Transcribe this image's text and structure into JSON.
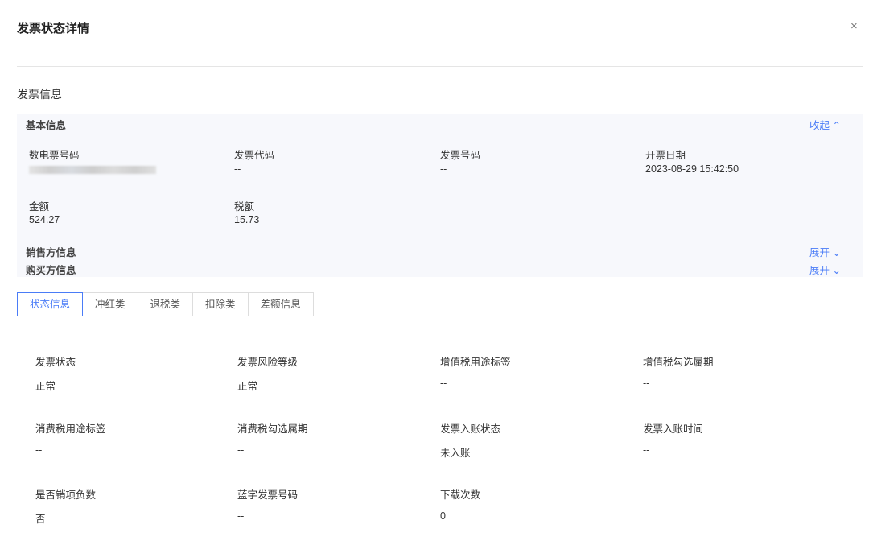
{
  "dialog": {
    "title": "发票状态详情",
    "close": "×"
  },
  "section_title": "发票信息",
  "basic": {
    "title": "基本信息",
    "toggle": "收起 ⌃",
    "fields": [
      {
        "label": "数电票号码",
        "value": ""
      },
      {
        "label": "发票代码",
        "value": "--"
      },
      {
        "label": "发票号码",
        "value": "--"
      },
      {
        "label": "开票日期",
        "value": "2023-08-29 15:42:50"
      },
      {
        "label": "金额",
        "value": "524.27"
      },
      {
        "label": "税额",
        "value": "15.73"
      }
    ]
  },
  "seller": {
    "title": "销售方信息",
    "toggle": "展开 ⌄"
  },
  "buyer": {
    "title": "购买方信息",
    "toggle": "展开 ⌄"
  },
  "tabs": [
    "状态信息",
    "冲红类",
    "退税类",
    "扣除类",
    "差额信息"
  ],
  "status": [
    {
      "label": "发票状态",
      "value": "正常"
    },
    {
      "label": "发票风险等级",
      "value": "正常"
    },
    {
      "label": "增值税用途标签",
      "value": "--"
    },
    {
      "label": "增值税勾选属期",
      "value": "--"
    },
    {
      "label": "消费税用途标签",
      "value": "--"
    },
    {
      "label": "消费税勾选属期",
      "value": "--"
    },
    {
      "label": "发票入账状态",
      "value": "未入账"
    },
    {
      "label": "发票入账时间",
      "value": "--"
    },
    {
      "label": "是否销项负数",
      "value": "否"
    },
    {
      "label": "蓝字发票号码",
      "value": "--"
    },
    {
      "label": "下载次数",
      "value": "0"
    }
  ]
}
